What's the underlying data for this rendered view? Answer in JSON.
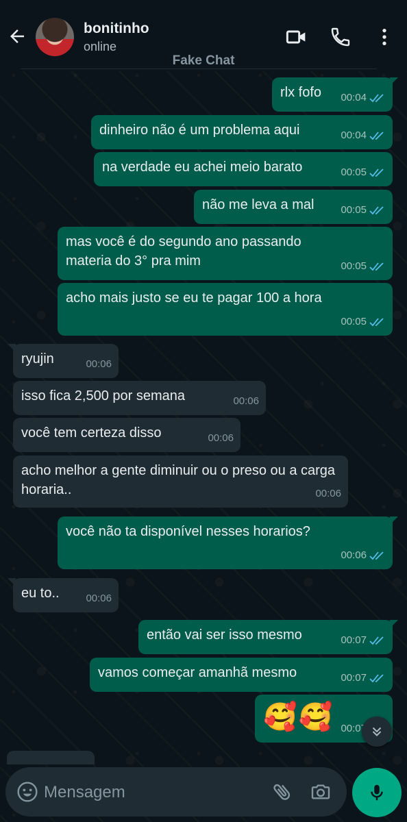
{
  "header": {
    "contact_name": "bonitinho",
    "status": "online",
    "watermark": "Fake Chat"
  },
  "messages": [
    {
      "dir": "out",
      "text": "rlx fofo",
      "time": "00:04"
    },
    {
      "dir": "out",
      "text": "dinheiro não é um problema aqui",
      "time": "00:04"
    },
    {
      "dir": "out",
      "text": "na verdade eu achei meio barato",
      "time": "00:05"
    },
    {
      "dir": "out",
      "text": "não me leva a mal",
      "time": "00:05"
    },
    {
      "dir": "out",
      "text": "mas você é do segundo ano passando materia do 3° pra mim",
      "time": "00:05"
    },
    {
      "dir": "out",
      "text": "acho mais justo se eu te pagar 100 a hora",
      "time": "00:05"
    },
    {
      "dir": "in",
      "text": "ryujin",
      "time": "00:06"
    },
    {
      "dir": "in",
      "text": "isso fica 2,500 por semana",
      "time": "00:06"
    },
    {
      "dir": "in",
      "text": "você tem certeza disso",
      "time": "00:06"
    },
    {
      "dir": "in",
      "text": "acho melhor a gente diminuir ou o preso ou a carga horaria..",
      "time": "00:06"
    },
    {
      "dir": "out",
      "text": "você não ta disponível nesses horarios?",
      "time": "00:06"
    },
    {
      "dir": "in",
      "text": "eu to..",
      "time": "00:06"
    },
    {
      "dir": "out",
      "text": "então vai ser isso mesmo",
      "time": "00:07"
    },
    {
      "dir": "out",
      "text": "vamos começar amanhã mesmo",
      "time": "00:07"
    },
    {
      "dir": "out",
      "text": "🥰🥰",
      "time": "00:07"
    }
  ],
  "input": {
    "placeholder": "Mensagem"
  },
  "icons": {
    "back": "back-arrow-icon",
    "video": "video-call-icon",
    "call": "phone-icon",
    "menu": "more-vertical-icon",
    "emoji": "emoji-icon",
    "attach": "paperclip-icon",
    "camera": "camera-icon",
    "mic": "mic-icon",
    "scroll": "chevron-double-down-icon"
  },
  "colors": {
    "outgoing_bubble": "#005c4b",
    "incoming_bubble": "#1f2c33",
    "accent": "#00a884",
    "read_ticks": "#53bdeb"
  }
}
